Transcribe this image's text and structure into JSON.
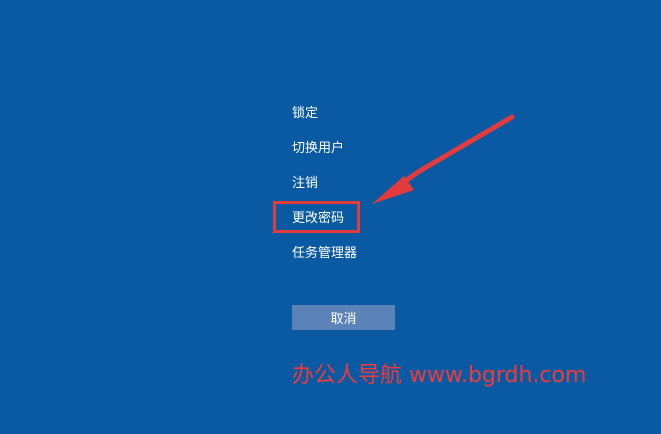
{
  "menu": {
    "items": [
      {
        "label": "锁定"
      },
      {
        "label": "切换用户"
      },
      {
        "label": "注销"
      },
      {
        "label": "更改密码"
      },
      {
        "label": "任务管理器"
      }
    ]
  },
  "cancel_label": "取消",
  "annotation": {
    "watermark": "办公人导航  www.bgrdh.com"
  },
  "colors": {
    "background": "#0a5aa3",
    "menu_text": "#ffffff",
    "button_bg": "#5b83b8",
    "highlight": "#e33b3b",
    "watermark": "#ef3a3a"
  }
}
